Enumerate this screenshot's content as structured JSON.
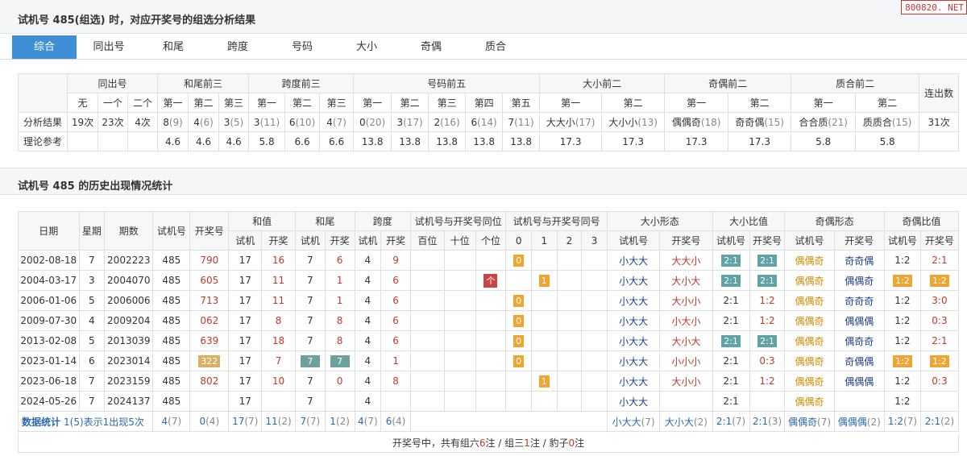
{
  "site_badge": "800820. NET",
  "sec1": {
    "title": "试机号 485(组选) 时，对应开奖号的组选分析结果"
  },
  "tabs": [
    "综合",
    "同出号",
    "和尾",
    "跨度",
    "号码",
    "大小",
    "奇偶",
    "质合"
  ],
  "t1": {
    "groups": [
      "同出号",
      "和尾前三",
      "跨度前三",
      "号码前五",
      "大小前二",
      "奇偶前二",
      "质合前二",
      "连出数"
    ],
    "subs": [
      "无",
      "一个",
      "二个",
      "第一",
      "第二",
      "第三",
      "第一",
      "第二",
      "第三",
      "第一",
      "第二",
      "第三",
      "第四",
      "第五",
      "第一",
      "第二",
      "第一",
      "第二",
      "第一",
      "第二"
    ],
    "row1_label": "分析结果",
    "row1": [
      [
        "19次",
        ""
      ],
      [
        "23次",
        ""
      ],
      [
        "4次",
        ""
      ],
      [
        "8",
        "(9)"
      ],
      [
        "4",
        "(6)"
      ],
      [
        "3",
        "(5)"
      ],
      [
        "3",
        "(11)"
      ],
      [
        "6",
        "(10)"
      ],
      [
        "4",
        "(7)"
      ],
      [
        "0",
        "(20)"
      ],
      [
        "3",
        "(17)"
      ],
      [
        "2",
        "(16)"
      ],
      [
        "6",
        "(14)"
      ],
      [
        "7",
        "(11)"
      ],
      [
        "大大小",
        "(17)"
      ],
      [
        "大小小",
        "(13)"
      ],
      [
        "偶偶奇",
        "(18)"
      ],
      [
        "奇奇偶",
        "(15)"
      ],
      [
        "合合质",
        "(21)"
      ],
      [
        "质质合",
        "(15)"
      ],
      [
        "31次",
        ""
      ]
    ],
    "row2_label": "理论参考",
    "row2": [
      "",
      "",
      "",
      "4.6",
      "4.6",
      "4.6",
      "5.8",
      "6.6",
      "6.6",
      "13.8",
      "13.8",
      "13.8",
      "13.8",
      "13.8",
      "17.3",
      "17.3",
      "17.3",
      "17.3",
      "5.8",
      "5.8",
      ""
    ]
  },
  "sec2": {
    "title": "试机号 485 的历史出现情况统计"
  },
  "t2": {
    "h1": [
      "日期",
      "星期",
      "期数",
      "试机号",
      "开奖号",
      "和值",
      "和尾",
      "跨度",
      "试机号与开奖号同位",
      "试机号与开奖号同号",
      "大小形态",
      "大小比值",
      "奇偶形态",
      "奇偶比值"
    ],
    "h2": [
      "试机",
      "开奖",
      "试机",
      "开奖",
      "试机",
      "开奖",
      "百位",
      "十位",
      "个位",
      "0",
      "1",
      "2",
      "3",
      "试机号",
      "开奖号",
      "试机号",
      "开奖号",
      "试机号",
      "开奖号",
      "试机号",
      "开奖号"
    ],
    "rows": [
      {
        "date": "2002-08-18",
        "week": "7",
        "issue": "2002223",
        "test": "485",
        "draw": "790",
        "sum_t": "17",
        "sum_d": "16",
        "tail_t": "7",
        "tail_d": "6",
        "span_t": "4",
        "span_d": "9",
        "pos_ge": "",
        "same": "0",
        "same_col": 0,
        "size_t": "小大大",
        "size_d": "大大小",
        "ratio_t": "2:1",
        "ratio_d": "2:1",
        "rt_box": true,
        "rd_box": true,
        "oe_t": "偶偶奇",
        "oe_d": "奇奇偶",
        "oer_t": "1:2",
        "oer_d": "2:1",
        "ot_box": false,
        "od_box": false
      },
      {
        "date": "2004-03-17",
        "week": "3",
        "issue": "2004070",
        "test": "485",
        "draw": "605",
        "sum_t": "17",
        "sum_d": "11",
        "tail_t": "7",
        "tail_d": "1",
        "span_t": "4",
        "span_d": "6",
        "pos_ge": "个",
        "same": "1",
        "same_col": 1,
        "size_t": "小大大",
        "size_d": "大小大",
        "ratio_t": "2:1",
        "ratio_d": "2:1",
        "rt_box": true,
        "rd_box": true,
        "oe_t": "偶偶奇",
        "oe_d": "偶偶奇",
        "oer_t": "1:2",
        "oer_d": "1:2",
        "ot_box": true,
        "od_box": true
      },
      {
        "date": "2006-01-06",
        "week": "5",
        "issue": "2006006",
        "test": "485",
        "draw": "713",
        "sum_t": "17",
        "sum_d": "11",
        "tail_t": "7",
        "tail_d": "1",
        "span_t": "4",
        "span_d": "6",
        "pos_ge": "",
        "same": "0",
        "same_col": 0,
        "size_t": "小大大",
        "size_d": "大小小",
        "ratio_t": "2:1",
        "ratio_d": "1:2",
        "rt_box": false,
        "rd_box": false,
        "oe_t": "偶偶奇",
        "oe_d": "奇奇奇",
        "oer_t": "1:2",
        "oer_d": "3:0",
        "ot_box": false,
        "od_box": false
      },
      {
        "date": "2009-07-30",
        "week": "4",
        "issue": "2009204",
        "test": "485",
        "draw": "062",
        "sum_t": "17",
        "sum_d": "8",
        "tail_t": "7",
        "tail_d": "8",
        "span_t": "4",
        "span_d": "6",
        "pos_ge": "",
        "same": "0",
        "same_col": 0,
        "size_t": "小大大",
        "size_d": "小大小",
        "ratio_t": "2:1",
        "ratio_d": "1:2",
        "rt_box": false,
        "rd_box": false,
        "oe_t": "偶偶奇",
        "oe_d": "偶偶偶",
        "oer_t": "1:2",
        "oer_d": "0:3",
        "ot_box": false,
        "od_box": false
      },
      {
        "date": "2013-02-08",
        "week": "5",
        "issue": "2013039",
        "test": "485",
        "draw": "639",
        "sum_t": "17",
        "sum_d": "18",
        "tail_t": "7",
        "tail_d": "8",
        "span_t": "4",
        "span_d": "6",
        "pos_ge": "",
        "same": "0",
        "same_col": 0,
        "size_t": "小大大",
        "size_d": "大小大",
        "ratio_t": "2:1",
        "ratio_d": "2:1",
        "rt_box": true,
        "rd_box": true,
        "oe_t": "偶偶奇",
        "oe_d": "偶奇奇",
        "oer_t": "1:2",
        "oer_d": "2:1",
        "ot_box": false,
        "od_box": false
      },
      {
        "date": "2023-01-14",
        "week": "6",
        "issue": "2023014",
        "test": "485",
        "draw": "322",
        "sum_t": "17",
        "sum_d": "7",
        "tail_t": "7",
        "tail_d": "7",
        "span_t": "4",
        "span_d": "1",
        "pos_ge": "",
        "same": "0",
        "same_col": 0,
        "size_t": "小大大",
        "size_d": "小小小",
        "ratio_t": "2:1",
        "ratio_d": "0:3",
        "rt_box": false,
        "rd_box": false,
        "oe_t": "偶偶奇",
        "oe_d": "奇偶偶",
        "oer_t": "1:2",
        "oer_d": "1:2",
        "ot_box": true,
        "od_box": true
      },
      {
        "date": "2023-06-18",
        "week": "7",
        "issue": "2023159",
        "test": "485",
        "draw": "802",
        "sum_t": "17",
        "sum_d": "10",
        "tail_t": "7",
        "tail_d": "0",
        "span_t": "4",
        "span_d": "8",
        "pos_ge": "",
        "same": "1",
        "same_col": 1,
        "size_t": "小大大",
        "size_d": "大小小",
        "ratio_t": "2:1",
        "ratio_d": "1:2",
        "rt_box": false,
        "rd_box": false,
        "oe_t": "偶偶奇",
        "oe_d": "偶偶偶",
        "oer_t": "1:2",
        "oer_d": "0:3",
        "ot_box": false,
        "od_box": false
      },
      {
        "date": "2024-05-26",
        "week": "7",
        "issue": "2024137",
        "test": "485",
        "draw": "",
        "sum_t": "17",
        "sum_d": "",
        "tail_t": "7",
        "tail_d": "",
        "span_t": "4",
        "span_d": "",
        "pos_ge": "",
        "same": "",
        "same_col": -1,
        "size_t": "小大大",
        "size_d": "",
        "ratio_t": "2:1",
        "ratio_d": "",
        "rt_box": false,
        "rd_box": false,
        "oe_t": "偶偶奇",
        "oe_d": "",
        "oer_t": "1:2",
        "oer_d": "",
        "ot_box": false,
        "od_box": false
      }
    ],
    "stats": {
      "label": "数据统计",
      "note": "1(5)表示1出现5次",
      "c": [
        [
          "4",
          "(7)"
        ],
        [
          "0",
          "(4)"
        ],
        [
          "17",
          "(7)"
        ],
        [
          "11",
          "(2)"
        ],
        [
          "7",
          "(7)"
        ],
        [
          "1",
          "(2)"
        ],
        [
          "4",
          "(7)"
        ],
        [
          "6",
          "(4)"
        ],
        [
          "小大大",
          "(7)"
        ],
        [
          "大小大",
          "(2)"
        ],
        [
          "2:1",
          "(7)"
        ],
        [
          "2:1",
          "(3)"
        ],
        [
          "偶偶奇",
          "(7)"
        ],
        [
          "偶偶偶",
          "(2)"
        ],
        [
          "1:2",
          "(7)"
        ],
        [
          "2:1",
          "(2)"
        ]
      ]
    }
  },
  "footer": {
    "prefix": "开奖号中，共有组六",
    "n6": "6",
    "mid6": "注 / 组三",
    "n3": "1",
    "mid3": "注 / 豹子",
    "nb": "0",
    "suffix": "注"
  }
}
